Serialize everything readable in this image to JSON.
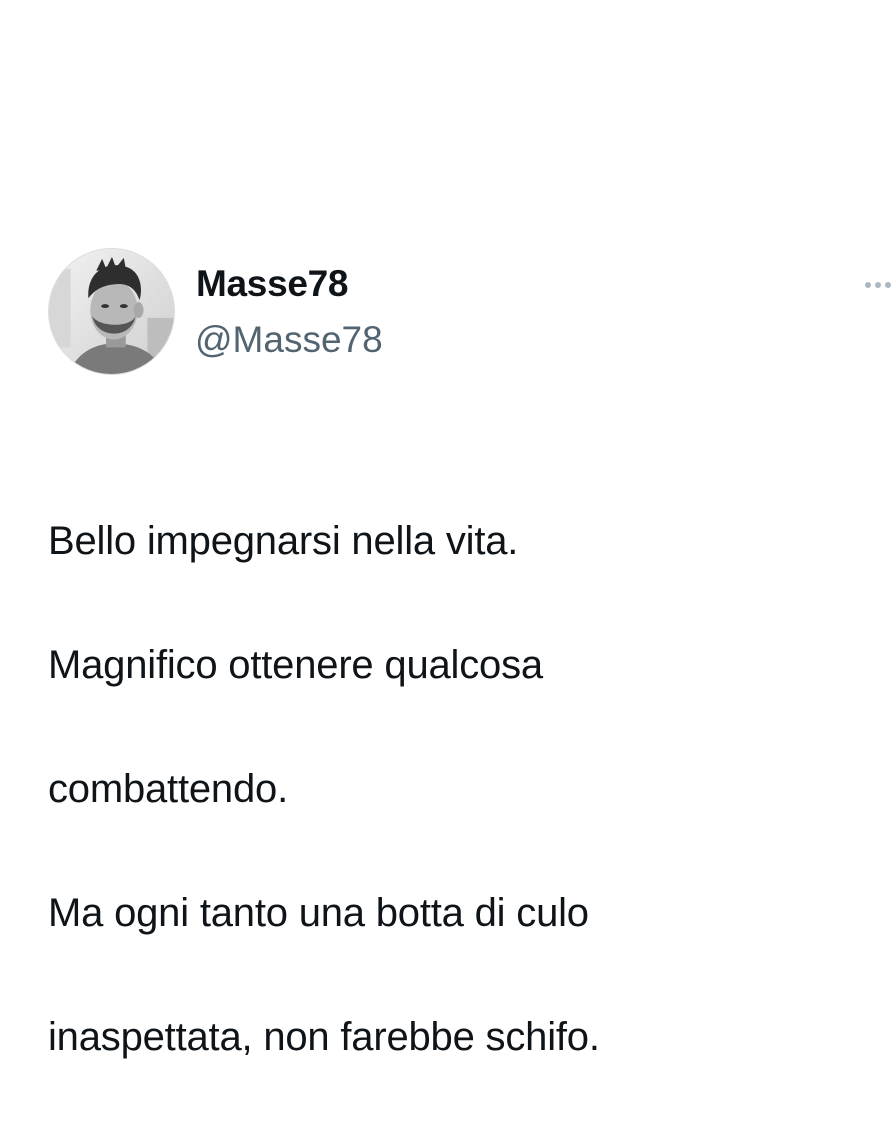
{
  "tweet": {
    "author": {
      "display_name": "Masse78",
      "handle": "@Masse78",
      "avatar_icon": "profile-photo"
    },
    "more_icon": "more-options-icon",
    "text_lines": [
      "Bello impegnarsi nella vita.",
      "Magnifico ottenere qualcosa",
      "combattendo.",
      "Ma ogni tanto una botta di culo",
      "inaspettata, non farebbe schifo."
    ]
  },
  "colors": {
    "text_primary": "#0f1419",
    "text_secondary": "#536471",
    "icon_gray": "#aab8c2",
    "background": "#ffffff"
  }
}
